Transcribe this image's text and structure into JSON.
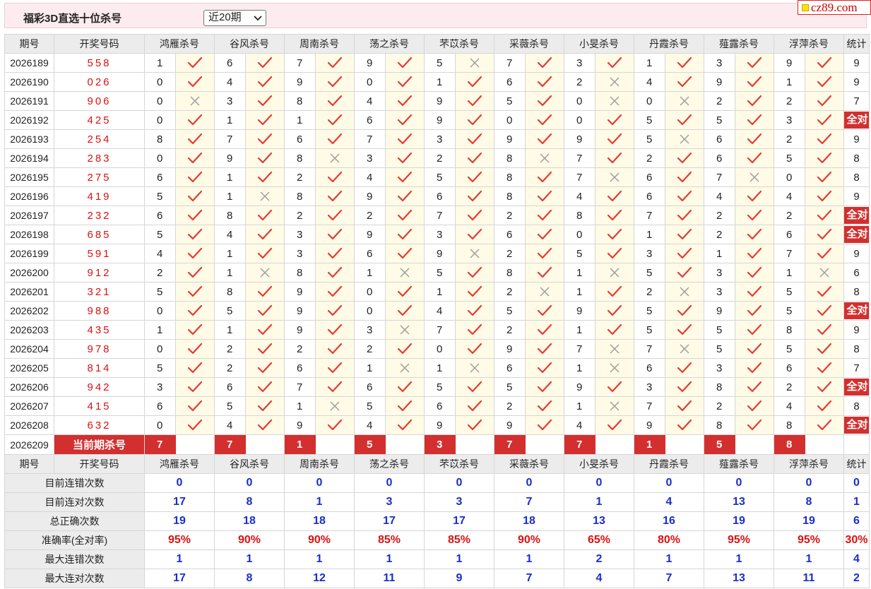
{
  "page": {
    "title": "福彩3D直选十位杀号",
    "period_option": "近20期",
    "brand": "cz89.com"
  },
  "table": {
    "headers": [
      "期号",
      "开奖号码",
      "鸿雁杀号",
      "谷风杀号",
      "周南杀号",
      "荡之杀号",
      "芣苡杀号",
      "采薇杀号",
      "小旻杀号",
      "丹霞杀号",
      "薤露杀号",
      "浮萍杀号",
      "统计"
    ],
    "rows": [
      {
        "p": "2026189",
        "d": "558",
        "n": [
          1,
          6,
          7,
          9,
          5,
          7,
          3,
          1,
          3,
          9
        ],
        "ok": [
          1,
          1,
          1,
          1,
          0,
          1,
          1,
          1,
          1,
          1
        ],
        "s": "9"
      },
      {
        "p": "2026190",
        "d": "026",
        "n": [
          0,
          4,
          9,
          0,
          1,
          6,
          2,
          4,
          9,
          1
        ],
        "ok": [
          1,
          1,
          1,
          1,
          1,
          1,
          0,
          1,
          1,
          1
        ],
        "s": "9"
      },
      {
        "p": "2026191",
        "d": "906",
        "n": [
          0,
          3,
          8,
          4,
          9,
          5,
          0,
          0,
          2,
          2
        ],
        "ok": [
          0,
          1,
          1,
          1,
          1,
          1,
          0,
          0,
          1,
          1
        ],
        "s": "7"
      },
      {
        "p": "2026192",
        "d": "425",
        "n": [
          0,
          1,
          1,
          6,
          9,
          0,
          0,
          5,
          5,
          3
        ],
        "ok": [
          1,
          1,
          1,
          1,
          1,
          1,
          1,
          1,
          1,
          1
        ],
        "s": "全对"
      },
      {
        "p": "2026193",
        "d": "254",
        "n": [
          8,
          7,
          6,
          7,
          3,
          9,
          9,
          5,
          6,
          2
        ],
        "ok": [
          1,
          1,
          1,
          1,
          1,
          1,
          1,
          0,
          1,
          1
        ],
        "s": "9"
      },
      {
        "p": "2026194",
        "d": "283",
        "n": [
          0,
          9,
          8,
          3,
          2,
          8,
          7,
          2,
          6,
          5
        ],
        "ok": [
          1,
          1,
          0,
          1,
          1,
          0,
          1,
          1,
          1,
          1
        ],
        "s": "8"
      },
      {
        "p": "2026195",
        "d": "275",
        "n": [
          6,
          1,
          2,
          4,
          5,
          8,
          7,
          6,
          7,
          0
        ],
        "ok": [
          1,
          1,
          1,
          1,
          1,
          1,
          0,
          1,
          0,
          1
        ],
        "s": "8"
      },
      {
        "p": "2026196",
        "d": "419",
        "n": [
          5,
          1,
          8,
          9,
          6,
          8,
          4,
          6,
          4,
          4
        ],
        "ok": [
          1,
          0,
          1,
          1,
          1,
          1,
          1,
          1,
          1,
          1
        ],
        "s": "9"
      },
      {
        "p": "2026197",
        "d": "232",
        "n": [
          6,
          8,
          2,
          2,
          7,
          2,
          8,
          7,
          2,
          2
        ],
        "ok": [
          1,
          1,
          1,
          1,
          1,
          1,
          1,
          1,
          1,
          1
        ],
        "s": "全对"
      },
      {
        "p": "2026198",
        "d": "685",
        "n": [
          5,
          4,
          3,
          9,
          3,
          6,
          0,
          1,
          2,
          6
        ],
        "ok": [
          1,
          1,
          1,
          1,
          1,
          1,
          1,
          1,
          1,
          1
        ],
        "s": "全对"
      },
      {
        "p": "2026199",
        "d": "591",
        "n": [
          4,
          1,
          3,
          6,
          9,
          2,
          5,
          3,
          1,
          7
        ],
        "ok": [
          1,
          1,
          1,
          1,
          0,
          1,
          1,
          1,
          1,
          1
        ],
        "s": "9"
      },
      {
        "p": "2026200",
        "d": "912",
        "n": [
          2,
          1,
          8,
          1,
          5,
          8,
          1,
          5,
          3,
          1
        ],
        "ok": [
          1,
          0,
          1,
          0,
          1,
          1,
          0,
          1,
          1,
          0
        ],
        "s": "6"
      },
      {
        "p": "2026201",
        "d": "321",
        "n": [
          5,
          8,
          9,
          0,
          1,
          2,
          1,
          2,
          3,
          5
        ],
        "ok": [
          1,
          1,
          1,
          1,
          1,
          0,
          1,
          0,
          1,
          1
        ],
        "s": "8"
      },
      {
        "p": "2026202",
        "d": "988",
        "n": [
          0,
          5,
          9,
          0,
          4,
          5,
          9,
          5,
          9,
          5
        ],
        "ok": [
          1,
          1,
          1,
          1,
          1,
          1,
          1,
          1,
          1,
          1
        ],
        "s": "全对"
      },
      {
        "p": "2026203",
        "d": "435",
        "n": [
          1,
          1,
          9,
          3,
          7,
          2,
          1,
          5,
          5,
          8
        ],
        "ok": [
          1,
          1,
          1,
          0,
          1,
          1,
          1,
          1,
          1,
          1
        ],
        "s": "9"
      },
      {
        "p": "2026204",
        "d": "978",
        "n": [
          0,
          2,
          2,
          2,
          0,
          9,
          7,
          7,
          5,
          5
        ],
        "ok": [
          1,
          1,
          1,
          1,
          1,
          1,
          0,
          0,
          1,
          1
        ],
        "s": "8"
      },
      {
        "p": "2026205",
        "d": "814",
        "n": [
          5,
          2,
          6,
          1,
          1,
          6,
          1,
          6,
          3,
          6
        ],
        "ok": [
          1,
          1,
          1,
          0,
          0,
          1,
          0,
          1,
          1,
          1
        ],
        "s": "7"
      },
      {
        "p": "2026206",
        "d": "942",
        "n": [
          3,
          6,
          7,
          6,
          5,
          5,
          9,
          3,
          8,
          2
        ],
        "ok": [
          1,
          1,
          1,
          1,
          1,
          1,
          1,
          1,
          1,
          1
        ],
        "s": "全对"
      },
      {
        "p": "2026207",
        "d": "415",
        "n": [
          6,
          5,
          1,
          5,
          6,
          2,
          1,
          7,
          2,
          4
        ],
        "ok": [
          1,
          1,
          0,
          1,
          1,
          1,
          0,
          1,
          1,
          1
        ],
        "s": "8"
      },
      {
        "p": "2026208",
        "d": "632",
        "n": [
          0,
          4,
          9,
          4,
          9,
          9,
          4,
          9,
          8,
          8
        ],
        "ok": [
          1,
          1,
          1,
          1,
          1,
          1,
          1,
          1,
          1,
          1
        ],
        "s": "全对"
      }
    ],
    "current": {
      "period": "2026209",
      "label": "当前期杀号",
      "kills": [
        "7",
        "7",
        "1",
        "5",
        "3",
        "7",
        "7",
        "1",
        "5",
        "8"
      ]
    },
    "summary": [
      {
        "label": "目前连错次数",
        "values": [
          "0",
          "0",
          "0",
          "0",
          "0",
          "0",
          "0",
          "0",
          "0",
          "0",
          "0"
        ]
      },
      {
        "label": "目前连对次数",
        "values": [
          "17",
          "8",
          "1",
          "3",
          "3",
          "7",
          "1",
          "4",
          "13",
          "8",
          "1"
        ]
      },
      {
        "label": "总正确次数",
        "values": [
          "19",
          "18",
          "18",
          "17",
          "17",
          "18",
          "13",
          "16",
          "19",
          "19",
          "6"
        ]
      },
      {
        "label": "准确率(全对率)",
        "values": [
          "95%",
          "90%",
          "90%",
          "85%",
          "85%",
          "90%",
          "65%",
          "80%",
          "95%",
          "95%",
          "30%"
        ]
      },
      {
        "label": "最大连错次数",
        "values": [
          "1",
          "1",
          "1",
          "1",
          "1",
          "1",
          "2",
          "1",
          "1",
          "1",
          "4"
        ]
      },
      {
        "label": "最大连对次数",
        "values": [
          "17",
          "8",
          "12",
          "11",
          "9",
          "7",
          "4",
          "7",
          "13",
          "11",
          "2"
        ]
      }
    ]
  },
  "colors": {
    "accent_red": "#d32f2f",
    "check_red": "#e53935",
    "cross_gray": "#9e9e9e",
    "summary_blue": "#1a2ecc"
  }
}
